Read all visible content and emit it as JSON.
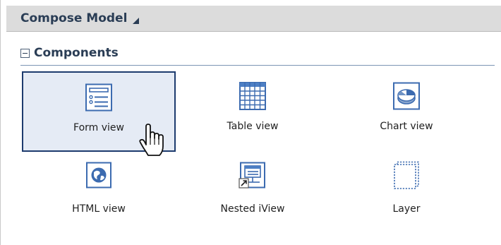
{
  "header": {
    "title": "Compose Model",
    "dropdown_icon": "triangle-down-icon"
  },
  "section": {
    "title": "Components",
    "toggle_icon": "collapse-minus-icon"
  },
  "components": [
    {
      "label": "Form view",
      "icon": "form-view-icon",
      "selected": true
    },
    {
      "label": "Table view",
      "icon": "table-view-icon",
      "selected": false
    },
    {
      "label": "Chart view",
      "icon": "chart-view-icon",
      "selected": false
    },
    {
      "label": "HTML view",
      "icon": "html-view-icon",
      "selected": false
    },
    {
      "label": "Nested iView",
      "icon": "nested-iview-icon",
      "selected": false
    },
    {
      "label": "Layer",
      "icon": "layer-icon",
      "selected": false
    }
  ],
  "colors": {
    "header_bg": "#dcdcdc",
    "title_text": "#2a3d55",
    "icon_blue": "#3c6bb0",
    "selection_bg": "#e5ebf5",
    "selection_border": "#1d3b6e"
  }
}
